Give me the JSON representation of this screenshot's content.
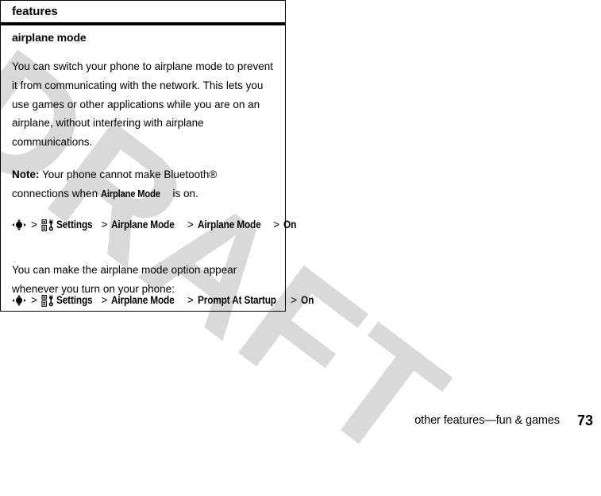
{
  "watermark": {
    "text": "DRAFT",
    "color": "#d9d9d9"
  },
  "header": {
    "title": "features"
  },
  "section": {
    "title": "airplane mode"
  },
  "paragraphs": {
    "intro": "You can switch your phone to airplane mode to prevent it from communicating with the network. This lets you use games or other applications while you are on an airplane, without interfering with airplane communications.",
    "note_label": "Note:",
    "note_part1": " Your phone cannot make Bluetooth® connections when ",
    "note_ui_label": "Airplane Mode",
    "note_part2": " is on.",
    "second": "You can make the airplane mode option appear whenever you turn on your phone:"
  },
  "path_one": {
    "nav_icon_name": "navigation-key-icon",
    "settings_icon_name": "settings-tools-icon",
    "separator": ">",
    "items": [
      "Settings",
      "Airplane Mode",
      "Airplane Mode",
      "On"
    ]
  },
  "path_two": {
    "nav_icon_name": "navigation-key-icon",
    "settings_icon_name": "settings-tools-icon",
    "separator": ">",
    "items": [
      "Settings",
      "Airplane Mode",
      "Prompt At Startup",
      "On"
    ]
  },
  "footer": {
    "title": "other features—fun & games",
    "page_number": "73"
  }
}
